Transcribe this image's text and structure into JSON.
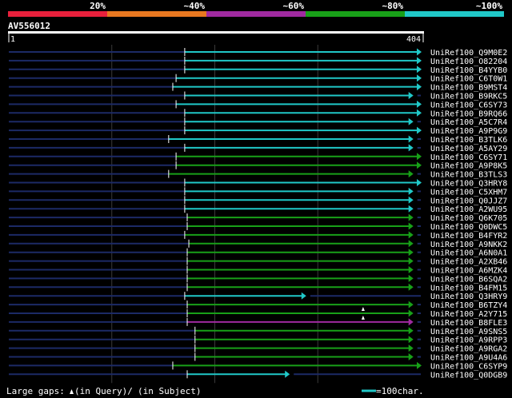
{
  "identity_scale": {
    "labels": [
      "20%",
      "~40%",
      "~60%",
      "~80%",
      "~100%"
    ],
    "colors": [
      "#e8203c",
      "#e87820",
      "#a02aa0",
      "#18a018",
      "#20c8c8"
    ]
  },
  "query": {
    "name": "AV556012",
    "start": "1",
    "end": "404",
    "length": 404
  },
  "hits": [
    {
      "name": "UniRef100_Q9M0E2",
      "color": "#20c8c8",
      "start": 0.427,
      "end": 1.0
    },
    {
      "name": "UniRef100_O82204",
      "color": "#20c8c8",
      "start": 0.427,
      "end": 1.0
    },
    {
      "name": "UniRef100_B4YYB0",
      "color": "#20c8c8",
      "start": 0.427,
      "end": 1.0
    },
    {
      "name": "UniRef100_C6T0W1",
      "color": "#20c8c8",
      "start": 0.406,
      "end": 1.0
    },
    {
      "name": "UniRef100_B9MST4",
      "color": "#20c8c8",
      "start": 0.398,
      "end": 1.0
    },
    {
      "name": "UniRef100_B9RKC5",
      "color": "#20c8c8",
      "start": 0.427,
      "end": 0.98
    },
    {
      "name": "UniRef100_C6SY73",
      "color": "#20c8c8",
      "start": 0.406,
      "end": 1.0
    },
    {
      "name": "UniRef100_B9RQ66",
      "color": "#20c8c8",
      "start": 0.427,
      "end": 1.0
    },
    {
      "name": "UniRef100_A5C7R4",
      "color": "#20c8c8",
      "start": 0.427,
      "end": 0.98
    },
    {
      "name": "UniRef100_A9P9G9",
      "color": "#20c8c8",
      "start": 0.427,
      "end": 1.0
    },
    {
      "name": "UniRef100_B3TLK6",
      "color": "#20c8c8",
      "start": 0.388,
      "end": 0.98
    },
    {
      "name": "UniRef100_A5AY29",
      "color": "#20c8c8",
      "start": 0.427,
      "end": 0.98
    },
    {
      "name": "UniRef100_C6SY71",
      "color": "#18a018",
      "start": 0.406,
      "end": 1.0
    },
    {
      "name": "UniRef100_A9P8K5",
      "color": "#18a018",
      "start": 0.406,
      "end": 1.0
    },
    {
      "name": "UniRef100_B3TLS3",
      "color": "#18a018",
      "start": 0.388,
      "end": 0.98
    },
    {
      "name": "UniRef100_Q3HRY8",
      "color": "#20c8c8",
      "start": 0.427,
      "end": 1.0
    },
    {
      "name": "UniRef100_C5XHM7",
      "color": "#20c8c8",
      "start": 0.427,
      "end": 0.98
    },
    {
      "name": "UniRef100_Q0JJZ7",
      "color": "#20c8c8",
      "start": 0.427,
      "end": 0.98
    },
    {
      "name": "UniRef100_A2WU95",
      "color": "#20c8c8",
      "start": 0.427,
      "end": 0.98
    },
    {
      "name": "UniRef100_Q6K705",
      "color": "#18a018",
      "start": 0.433,
      "end": 0.98
    },
    {
      "name": "UniRef100_Q0DWC5",
      "color": "#18a018",
      "start": 0.433,
      "end": 0.98
    },
    {
      "name": "UniRef100_B4FYR2",
      "color": "#18a018",
      "start": 0.427,
      "end": 0.98
    },
    {
      "name": "UniRef100_A9NKK2",
      "color": "#18a018",
      "start": 0.437,
      "end": 0.98
    },
    {
      "name": "UniRef100_A6N0A1",
      "color": "#18a018",
      "start": 0.433,
      "end": 0.98
    },
    {
      "name": "UniRef100_A2XB46",
      "color": "#18a018",
      "start": 0.433,
      "end": 0.98
    },
    {
      "name": "UniRef100_A6MZK4",
      "color": "#18a018",
      "start": 0.433,
      "end": 0.98
    },
    {
      "name": "UniRef100_B6SQA2",
      "color": "#18a018",
      "start": 0.433,
      "end": 0.98
    },
    {
      "name": "UniRef100_B4FM15",
      "color": "#18a018",
      "start": 0.433,
      "end": 0.98
    },
    {
      "name": "UniRef100_Q3HRY9",
      "color": "#20c8c8",
      "start": 0.427,
      "end": 0.72
    },
    {
      "name": "UniRef100_B6TZY4",
      "color": "#18a018",
      "start": 0.433,
      "end": 0.98
    },
    {
      "name": "UniRef100_A2Y715",
      "color": "#18a018",
      "start": 0.433,
      "end": 0.98,
      "gap": 0.86
    },
    {
      "name": "UniRef100_B8FLE3",
      "color": "#a02aa0",
      "start": 0.433,
      "end": 0.98,
      "gap": 0.86
    },
    {
      "name": "UniRef100_A9SNS5",
      "color": "#18a018",
      "start": 0.452,
      "end": 0.98
    },
    {
      "name": "UniRef100_A9RPP3",
      "color": "#18a018",
      "start": 0.452,
      "end": 0.98
    },
    {
      "name": "UniRef100_A9RGA2",
      "color": "#18a018",
      "start": 0.452,
      "end": 0.98
    },
    {
      "name": "UniRef100_A9U4A6",
      "color": "#18a018",
      "start": 0.452,
      "end": 0.98
    },
    {
      "name": "UniRef100_C6SYP9",
      "color": "#18a018",
      "start": 0.398,
      "end": 1.0
    },
    {
      "name": "UniRef100_Q0DGB9",
      "color": "#20c8c8",
      "start": 0.433,
      "end": 0.68
    }
  ],
  "footer": {
    "large_gaps_text": "Large gaps:",
    "in_query_text": "(in Query)/",
    "dash_text": "—",
    "in_subject_text": " (in Subject)",
    "scale_text": "=100char."
  }
}
